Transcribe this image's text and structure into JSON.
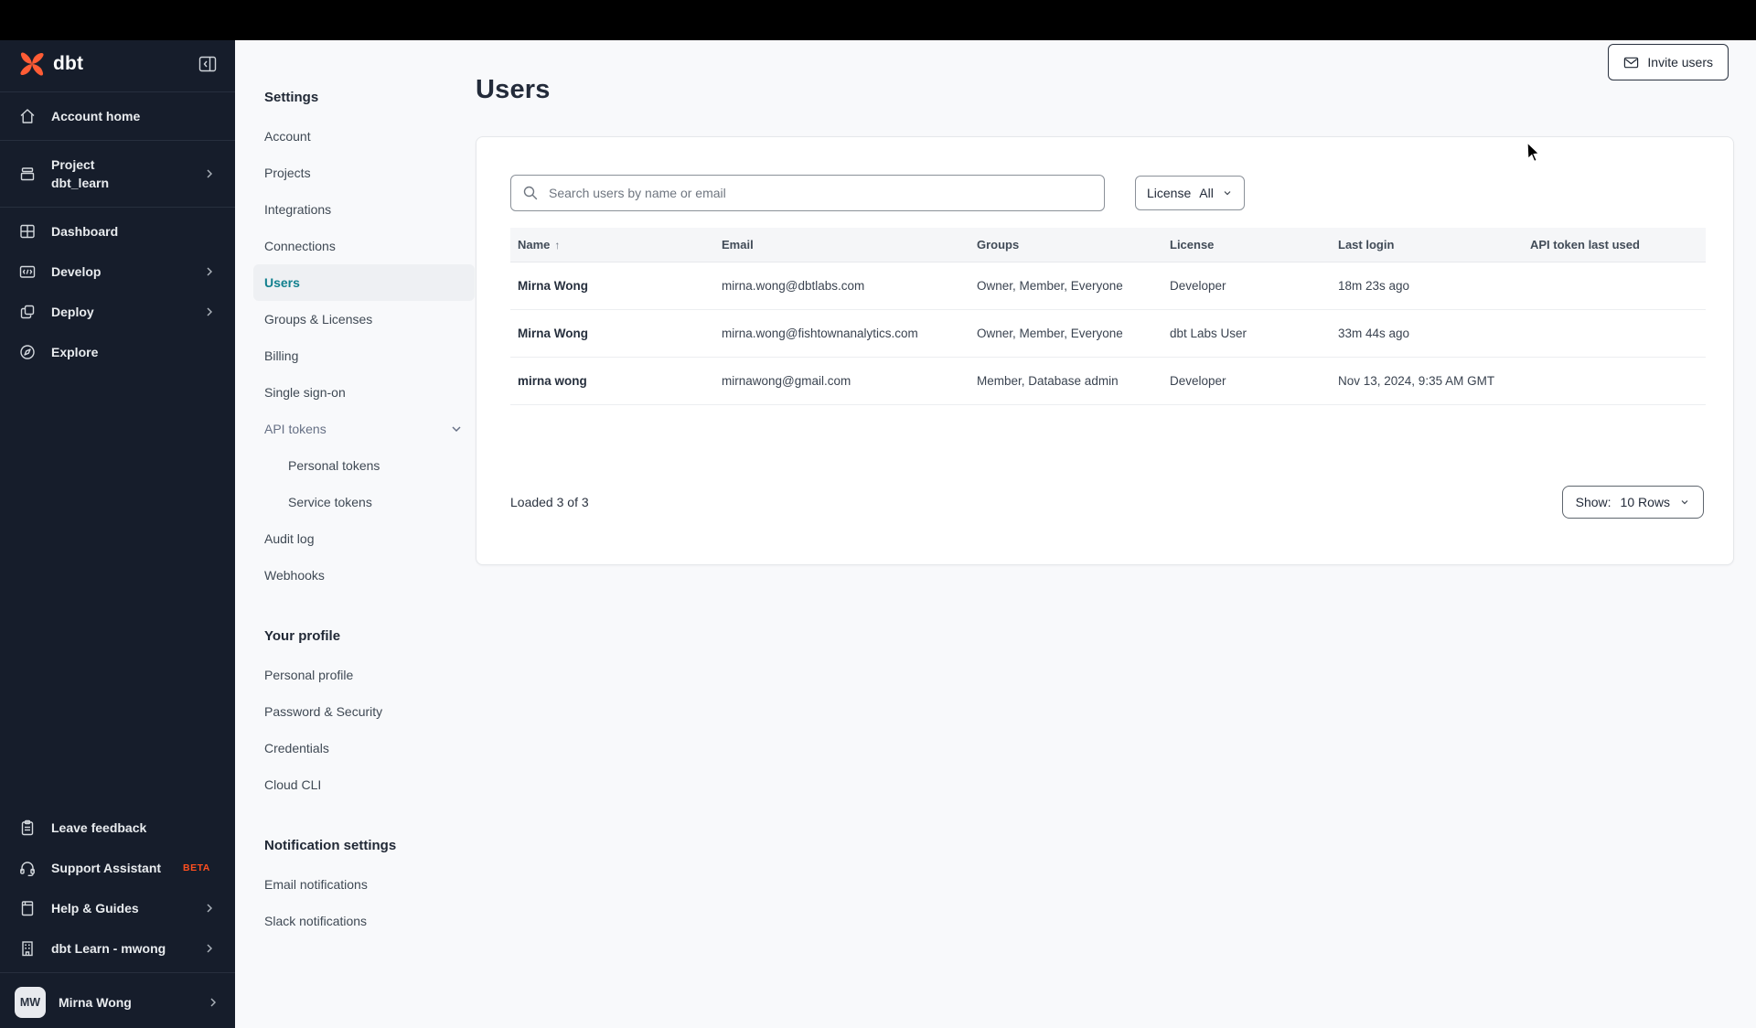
{
  "sidebar": {
    "logo_text": "dbt",
    "items": [
      {
        "label": "Account home"
      },
      {
        "label": "Project",
        "sublabel": "dbt_learn"
      },
      {
        "label": "Dashboard"
      },
      {
        "label": "Develop"
      },
      {
        "label": "Deploy"
      },
      {
        "label": "Explore"
      }
    ],
    "footer_items": [
      {
        "label": "Leave feedback"
      },
      {
        "label": "Support Assistant",
        "badge": "BETA"
      },
      {
        "label": "Help & Guides"
      },
      {
        "label": "dbt Learn - mwong"
      }
    ],
    "user": {
      "initials": "MW",
      "name": "Mirna Wong"
    }
  },
  "settings_nav": {
    "heading": "Settings",
    "items": [
      {
        "label": "Account"
      },
      {
        "label": "Projects"
      },
      {
        "label": "Integrations"
      },
      {
        "label": "Connections"
      },
      {
        "label": "Users",
        "active": true
      },
      {
        "label": "Groups & Licenses"
      },
      {
        "label": "Billing"
      },
      {
        "label": "Single sign-on"
      }
    ],
    "api_tokens_label": "API tokens",
    "api_token_children": [
      {
        "label": "Personal tokens"
      },
      {
        "label": "Service tokens"
      }
    ],
    "post_items": [
      {
        "label": "Audit log"
      },
      {
        "label": "Webhooks"
      }
    ],
    "profile_heading": "Your profile",
    "profile_items": [
      {
        "label": "Personal profile"
      },
      {
        "label": "Password & Security"
      },
      {
        "label": "Credentials"
      },
      {
        "label": "Cloud CLI"
      }
    ],
    "notifications_heading": "Notification settings",
    "notification_items": [
      {
        "label": "Email notifications"
      },
      {
        "label": "Slack notifications"
      }
    ]
  },
  "main": {
    "title": "Users",
    "invite_button_label": "Invite users",
    "search_placeholder": "Search users by name or email",
    "license_filter": {
      "label": "License",
      "value": "All"
    },
    "table": {
      "columns": [
        "Name",
        "Email",
        "Groups",
        "License",
        "Last login",
        "API token last used"
      ],
      "sort_arrow": "↑",
      "rows": [
        {
          "name": "Mirna Wong",
          "email": "mirna.wong@dbtlabs.com",
          "groups": "Owner, Member, Everyone",
          "license": "Developer",
          "last_login": "18m 23s ago",
          "api_token_last_used": ""
        },
        {
          "name": "Mirna Wong",
          "email": "mirna.wong@fishtownanalytics.com",
          "groups": "Owner, Member, Everyone",
          "license": "dbt Labs User",
          "last_login": "33m 44s ago",
          "api_token_last_used": ""
        },
        {
          "name": "mirna wong",
          "email": "mirnawong@gmail.com",
          "groups": "Member, Database admin",
          "license": "Developer",
          "last_login": "Nov 13, 2024, 9:35 AM GMT",
          "api_token_last_used": ""
        }
      ]
    },
    "footer": {
      "loaded_text": "Loaded 3 of 3",
      "show_label": "Show:",
      "show_value": "10 Rows"
    }
  },
  "colors": {
    "brand_orange": "#ff5c35",
    "beta_orange": "#ff4f1f",
    "active_teal": "#12808e",
    "sidebar_bg": "#161d2b",
    "topbar_bg": "#000000",
    "page_bg": "#f8f9fb"
  }
}
